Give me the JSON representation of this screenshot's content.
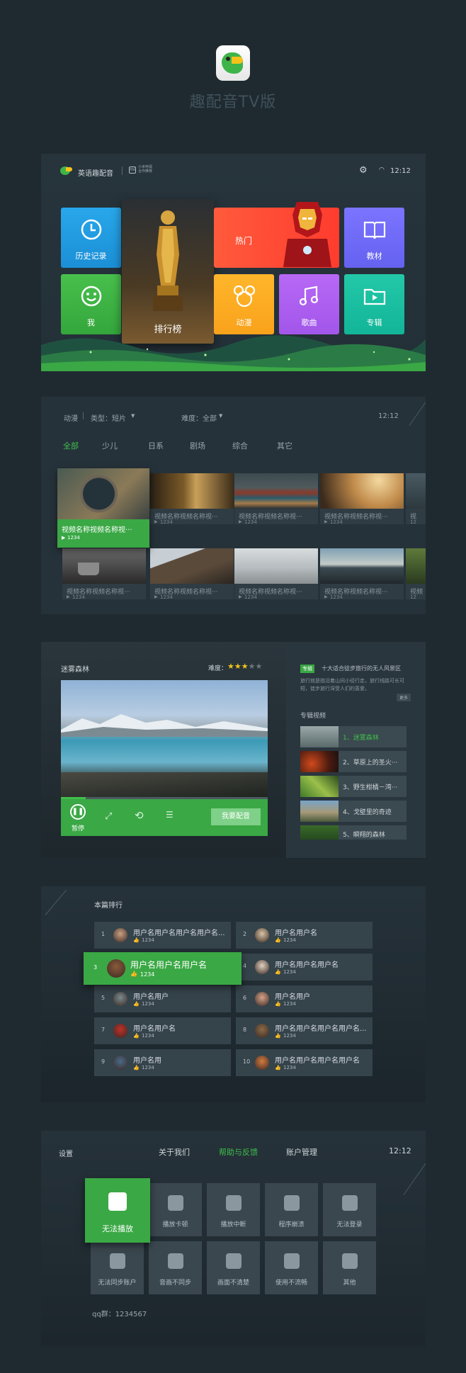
{
  "app": {
    "name": "趣配音TV版"
  },
  "home": {
    "brand": "英语趣配音",
    "partner_line1": "小米电视",
    "partner_line2": "合作推荐",
    "time": "12:12",
    "tiles": {
      "history": "历史记录",
      "me": "我",
      "ranking": "排行榜",
      "hot": "热门",
      "textbook": "教材",
      "anime": "动漫",
      "songs": "歌曲",
      "album": "专辑"
    }
  },
  "browse": {
    "filter_category": "动漫",
    "filter_type": "类型：短片",
    "filter_difficulty": "难度：全部",
    "time": "12:12",
    "tabs": [
      "全部",
      "少儿",
      "日系",
      "剧场",
      "综合",
      "其它"
    ],
    "videos": [
      {
        "title": "视频名称视频名称视···",
        "count": "1234"
      },
      {
        "title": "视频名称视频名称视···",
        "count": "1234"
      },
      {
        "title": "视频名称视频名称视···",
        "count": "1234"
      },
      {
        "title": "视频名称视频名称视···",
        "count": "1234"
      },
      {
        "title": "视",
        "count": "12"
      },
      {
        "title": "视频名称视频名称视···",
        "count": "1234"
      },
      {
        "title": "视频名称视频名称视···",
        "count": "1234"
      },
      {
        "title": "视频名称视频名称视···",
        "count": "1234"
      },
      {
        "title": "视频名称视频名称视···",
        "count": "1234"
      },
      {
        "title": "视频",
        "count": "12"
      }
    ]
  },
  "player": {
    "title": "迷雾森林",
    "difficulty_label": "难度：",
    "difficulty_stars": 3,
    "difficulty_max": 5,
    "pause_label": "暂停",
    "dub_button": "我要配音",
    "progress": 0.12,
    "album_badge": "专辑",
    "album_title": "十大适合徒步旅行的无人风景区",
    "album_desc": "旅行就是指沿着山间小径行走，旅行线路可长可短，徒步旅行深受人们的喜爱。",
    "more": "更多",
    "album_videos_label": "专辑视频",
    "album_videos": [
      "1、迷雾森林",
      "2、草原上的圣火···",
      "3、野生柑橘－湾···",
      "4、戈壁里的奇迹",
      "5、瞬翔的森林"
    ]
  },
  "ranking": {
    "title": "本篇排行",
    "entries": [
      {
        "no": "1",
        "name": "用户名用户名用户名用户名...",
        "likes": "1234"
      },
      {
        "no": "2",
        "name": "用户名用户名",
        "likes": "1234"
      },
      {
        "no": "3",
        "name": "用户名用户名用户名",
        "likes": "1234"
      },
      {
        "no": "4",
        "name": "用户名用户名用户名",
        "likes": "1234"
      },
      {
        "no": "5",
        "name": "用户名用户",
        "likes": "1234"
      },
      {
        "no": "6",
        "name": "用户名用户",
        "likes": "1234"
      },
      {
        "no": "7",
        "name": "用户名用户名",
        "likes": "1234"
      },
      {
        "no": "8",
        "name": "用户名用户名用户名用户名...",
        "likes": "1234"
      },
      {
        "no": "9",
        "name": "用户名用",
        "likes": "1234"
      },
      {
        "no": "10",
        "name": "用户名用户名用户名用户名",
        "likes": "1234"
      }
    ]
  },
  "settings": {
    "title": "设置",
    "tabs": [
      "关于我们",
      "帮助与反馈",
      "账户管理"
    ],
    "active_tab": "帮助与反馈",
    "time": "12:12",
    "items": [
      "无法播放",
      "播放卡顿",
      "播放中断",
      "程序崩溃",
      "无法登录",
      "无法同步账户",
      "音画不同步",
      "画面不清楚",
      "使用不流畅",
      "其他"
    ],
    "qq": "qq群：1234567"
  },
  "colors": {
    "accent": "#3aa845",
    "bg": "#1f2a30",
    "panel": "#26323a"
  }
}
